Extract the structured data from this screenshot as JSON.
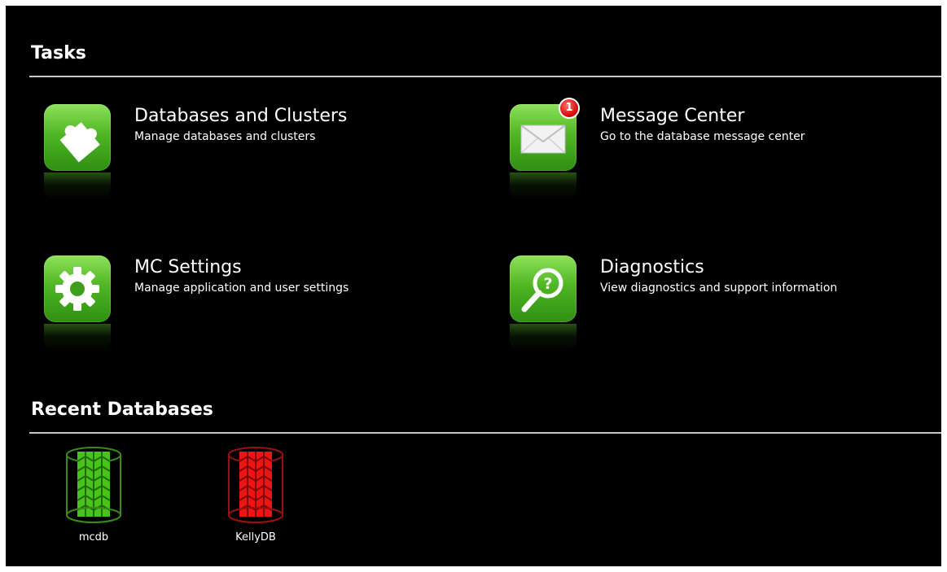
{
  "tasks": {
    "heading": "Tasks",
    "items": [
      {
        "title": "Databases and Clusters",
        "description": "Manage databases and clusters",
        "icon": "puzzle-icon"
      },
      {
        "title": "Message Center",
        "description": "Go to the database message center",
        "icon": "envelope-icon",
        "badge": "1"
      },
      {
        "title": "MC Settings",
        "description": "Manage application and user settings",
        "icon": "gear-icon"
      },
      {
        "title": "Diagnostics",
        "description": "View diagnostics and support information",
        "icon": "magnifier-question-icon"
      }
    ]
  },
  "recent": {
    "heading": "Recent Databases",
    "databases": [
      {
        "name": "mcdb",
        "status_color": "#3fd414"
      },
      {
        "name": "KellyDB",
        "status_color": "#ff1010"
      }
    ]
  },
  "colors": {
    "background": "#000000",
    "accent": "#4fb624",
    "badge": "#d40000"
  }
}
